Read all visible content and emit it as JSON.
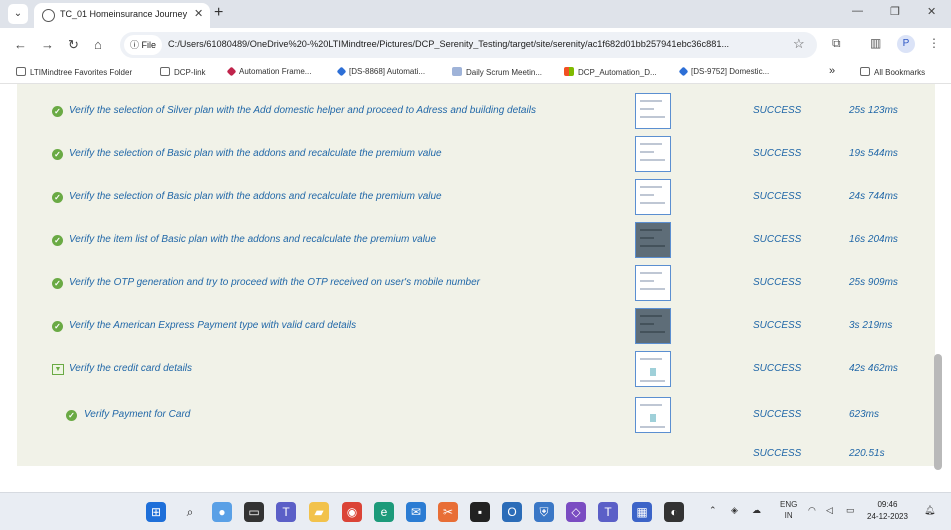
{
  "browser": {
    "tab": {
      "title": "TC_01 Homeinsurance Journey",
      "close": "✕"
    },
    "new_tab": "+",
    "nav": {
      "back": "←",
      "forward": "→",
      "reload": "↻",
      "home": "⌂"
    },
    "site_info": "File",
    "url": "C:/Users/61080489/OneDrive%20-%20LTIMindtree/Pictures/DCP_Serenity_Testing/target/site/serenity/ac1f682d01bb257941ebc36c881...",
    "bookmarks": [
      "LTIMindtree Favorites Folder",
      "DCP-link",
      "Automation Frame...",
      "[DS-8868] Automati...",
      "Daily Scrum Meetin...",
      "DCP_Automation_D...",
      "[DS-9752] Domestic...",
      "All Bookmarks"
    ],
    "bookmarks_more": "»",
    "window": {
      "minimize": "—",
      "restore": "❐",
      "close": "✕"
    },
    "profile_initial": "P"
  },
  "report": {
    "rows": [
      {
        "title": "Verify the selection of Silver plan with the Add domestic helper and proceed to Adress and building details",
        "result": "SUCCESS",
        "duration": "25s 123ms",
        "status": "pass",
        "thumb": "light"
      },
      {
        "title": "Verify the selection of Basic plan with the addons and recalculate the premium value",
        "result": "SUCCESS",
        "duration": "19s 544ms",
        "status": "pass",
        "thumb": "light"
      },
      {
        "title": "Verify the selection of Basic plan with the addons and recalculate the premium value",
        "result": "SUCCESS",
        "duration": "24s 744ms",
        "status": "pass",
        "thumb": "light"
      },
      {
        "title": "Verify the item list of Basic plan with the addons and recalculate the premium value",
        "result": "SUCCESS",
        "duration": "16s 204ms",
        "status": "pass",
        "thumb": "dark"
      },
      {
        "title": "Verify the OTP generation and try to proceed with the OTP received on user's mobile number",
        "result": "SUCCESS",
        "duration": "25s 909ms",
        "status": "pass",
        "thumb": "light"
      },
      {
        "title": "Verify the American Express Payment type with valid card details",
        "result": "SUCCESS",
        "duration": "3s 219ms",
        "status": "pass",
        "thumb": "dark"
      },
      {
        "title": "Verify the credit card details",
        "result": "SUCCESS",
        "duration": "42s 462ms",
        "status": "toggle",
        "thumb": "light"
      },
      {
        "title": "Verify Payment for Card",
        "result": "SUCCESS",
        "duration": "623ms",
        "status": "pass-child",
        "thumb": "light"
      }
    ],
    "total": {
      "result": "SUCCESS",
      "duration": "220.51s"
    }
  },
  "taskbar": {
    "language": "ENG",
    "region": "IN",
    "time": "09:46",
    "date": "24-12-2023",
    "notification_badge": "1"
  },
  "colors": {
    "report_bg": "#f1f2e8",
    "link_text": "#2268a8",
    "pass_green": "#6aaa44",
    "thumb_border": "#5b8fd1"
  }
}
